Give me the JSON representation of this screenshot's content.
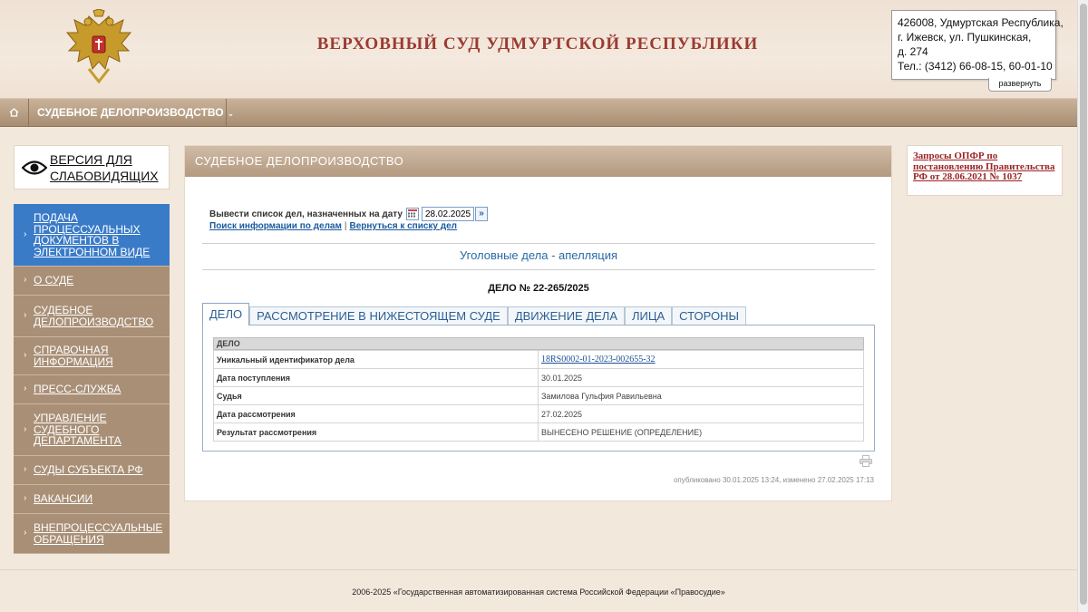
{
  "header": {
    "title": "ВЕРХОВНЫЙ СУД УДМУРТСКОЙ РЕСПУБЛИКИ",
    "contact": {
      "line1": "426008, Удмуртская Республика,",
      "line2": "г. Ижевск, ул. Пушкинская,",
      "line3": "д. 274",
      "line4": "Тел.: (3412) 66-08-15, 60-01-10",
      "expand_label": "развернуть"
    }
  },
  "nav": {
    "home_icon": "home-icon",
    "item_label": "СУДЕБНОЕ ДЕЛОПРОИЗВОДСТВО",
    "chevron": "⌄"
  },
  "left": {
    "vision_label_1": "ВЕРСИЯ ДЛЯ",
    "vision_label_2": "СЛАБОВИДЯЩИХ",
    "menu": [
      {
        "label": "Подача процессуальных документов в электронном виде",
        "active": true
      },
      {
        "label": "О суде",
        "active": false
      },
      {
        "label": "Судебное делопроизводство",
        "active": false
      },
      {
        "label": "Справочная информация",
        "active": false
      },
      {
        "label": "Пресс-служба",
        "active": false
      },
      {
        "label": "Управление Судебного департамента",
        "active": false
      },
      {
        "label": "Суды субъекта РФ",
        "active": false
      },
      {
        "label": "Вакансии",
        "active": false
      },
      {
        "label": "Внепроцессуальные обращения",
        "active": false
      }
    ]
  },
  "main": {
    "panel_title": "СУДЕБНОЕ ДЕЛОПРОИЗВОДСТВО",
    "date_label": "Вывести список дел, назначенных на дату",
    "date_value": "28.02.2025",
    "go_symbol": "»",
    "link_search": "Поиск информации по делам",
    "link_separator": "|",
    "link_back": "Вернуться к списку дел",
    "category": "Уголовные дела - апелляция",
    "case_number": "ДЕЛО № 22-265/2025",
    "tabs": [
      {
        "label": "ДЕЛО",
        "active": true
      },
      {
        "label": "РАССМОТРЕНИЕ В НИЖЕСТОЯЩЕМ СУДЕ",
        "active": false
      },
      {
        "label": "ДВИЖЕНИЕ ДЕЛА",
        "active": false
      },
      {
        "label": "ЛИЦА",
        "active": false
      },
      {
        "label": "СТОРОНЫ",
        "active": false
      }
    ],
    "table_header": "ДЕЛО",
    "rows": [
      {
        "key": "Уникальный идентификатор дела",
        "value": "18RS0002-01-2023-002655-32"
      },
      {
        "key": "Дата поступления",
        "value": "30.01.2025"
      },
      {
        "key": "Судья",
        "value": "Замилова Гульфия Равильевна"
      },
      {
        "key": "Дата рассмотрения",
        "value": "27.02.2025"
      },
      {
        "key": "Результат рассмотрения",
        "value": "ВЫНЕСЕНО РЕШЕНИЕ (ОПРЕДЕЛЕНИЕ)"
      }
    ],
    "published": "опубликовано 30.01.2025 13:24, изменено 27.02.2025 17:13"
  },
  "right": {
    "opfr_link": "Запросы ОПФР по постановлению Правительства РФ от 28.06.2021 № 1037"
  },
  "footer": {
    "text": "2006-2025 «Государственная автоматизированная система Российской Федерации «Правосудие»"
  },
  "colors": {
    "accent_blue": "#3a7bc8",
    "menu_brown": "#a88f76",
    "title_red": "#9b3b32",
    "link_blue": "#1a5a9e"
  }
}
